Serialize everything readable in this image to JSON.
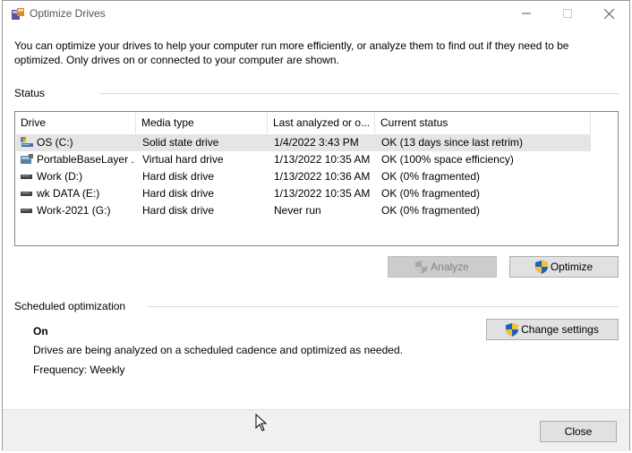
{
  "window": {
    "title": "Optimize Drives",
    "controls": {
      "minimize": "—",
      "maximize": "☐",
      "close": "✕"
    }
  },
  "description": "You can optimize your drives to help your computer run more efficiently, or analyze them to find out if they need to be optimized. Only drives on or connected to your computer are shown.",
  "status": {
    "label": "Status",
    "columns": [
      "Drive",
      "Media type",
      "Last analyzed or o...",
      "Current status"
    ],
    "rows": [
      {
        "drive": "OS (C:)",
        "media": "Solid state drive",
        "last": "1/4/2022 3:43 PM",
        "status": "OK (13 days since last retrim)",
        "icon": "os-drive-icon"
      },
      {
        "drive": "PortableBaseLayer ...",
        "media": "Virtual hard drive",
        "last": "1/13/2022 10:35 AM",
        "status": "OK (100% space efficiency)",
        "icon": "virtual-drive-icon"
      },
      {
        "drive": "Work (D:)",
        "media": "Hard disk drive",
        "last": "1/13/2022 10:36 AM",
        "status": "OK (0% fragmented)",
        "icon": "hard-disk-icon"
      },
      {
        "drive": "wk DATA (E:)",
        "media": "Hard disk drive",
        "last": "1/13/2022 10:35 AM",
        "status": "OK (0% fragmented)",
        "icon": "hard-disk-icon"
      },
      {
        "drive": "Work-2021 (G:)",
        "media": "Hard disk drive",
        "last": "Never run",
        "status": "OK (0% fragmented)",
        "icon": "hard-disk-icon"
      }
    ],
    "selected_row": 0
  },
  "actions": {
    "analyze": "Analyze",
    "optimize": "Optimize"
  },
  "scheduled": {
    "label": "Scheduled optimization",
    "state": "On",
    "description": "Drives are being analyzed on a scheduled cadence and optimized as needed.",
    "frequency": "Frequency: Weekly",
    "change_settings": "Change settings"
  },
  "footer": {
    "close": "Close"
  },
  "colors": {
    "selected_row": "#e5e5e5",
    "button_face": "#e1e1e1",
    "disabled_button": "#cccccc",
    "footer_bg": "#f0f0f0"
  }
}
